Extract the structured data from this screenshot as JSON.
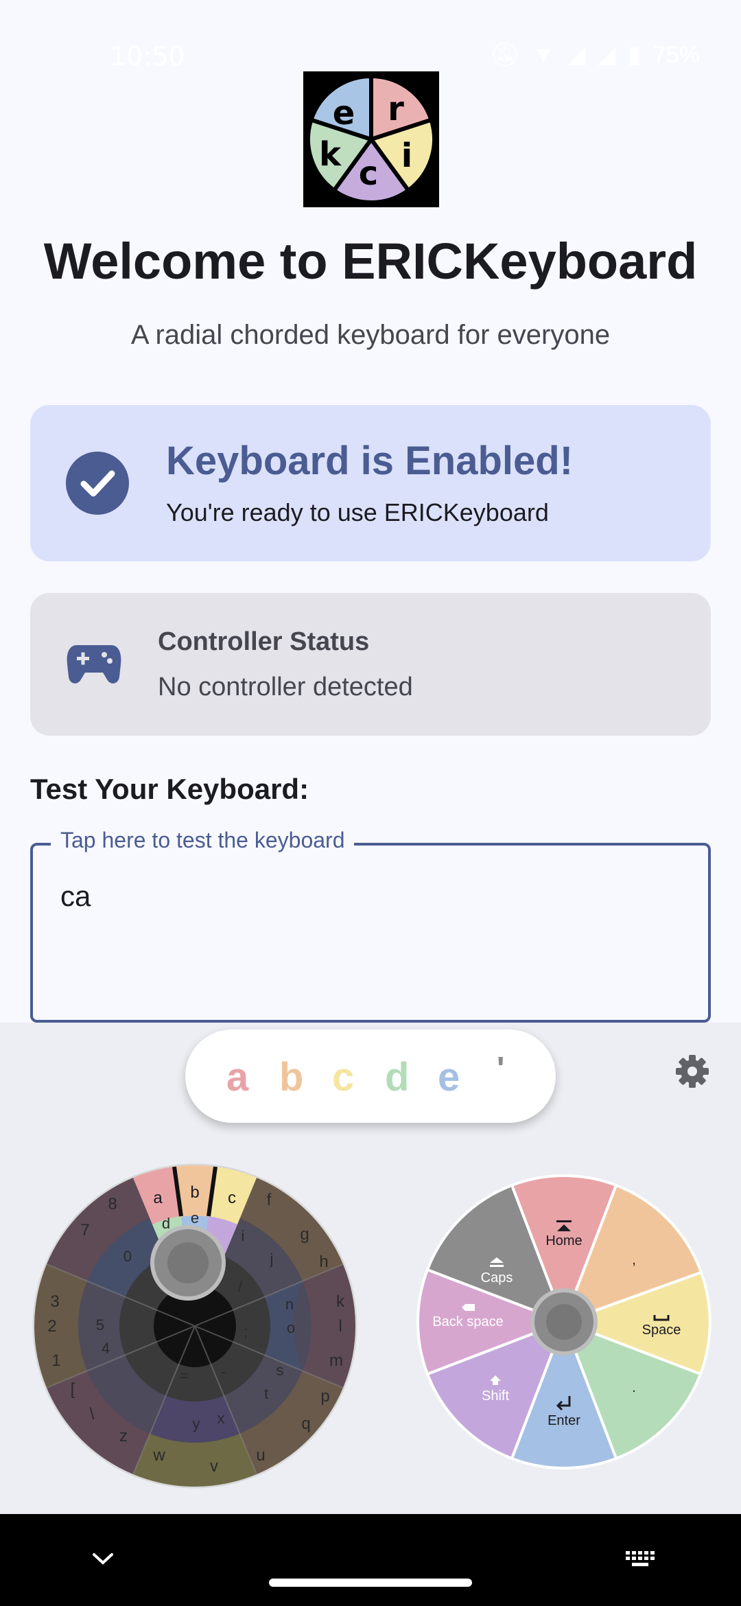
{
  "status_bar": {
    "time": "10:50",
    "battery": "75%",
    "icons": [
      "mute-icon",
      "wifi-icon",
      "signal-icon",
      "signal-icon",
      "battery-icon"
    ]
  },
  "app": {
    "logo_letters": [
      "e",
      "r",
      "k",
      "c",
      "i"
    ],
    "title": "Welcome to ERICKeyboard",
    "subtitle": "A radial chorded keyboard for everyone"
  },
  "enabled_card": {
    "title": "Keyboard is Enabled!",
    "subtitle": "You're ready to use ERICKeyboard",
    "icon": "check-circle-icon",
    "accent": "#4a5c92"
  },
  "controller_card": {
    "title": "Controller Status",
    "subtitle": "No controller detected",
    "icon": "gamepad-icon"
  },
  "test": {
    "label": "Test Your Keyboard:",
    "field_label": "Tap here to test the keyboard",
    "value": "ca"
  },
  "keyboard": {
    "suggestions": [
      {
        "text": "a",
        "color": "#e8a3a6"
      },
      {
        "text": "b",
        "color": "#f1c59b"
      },
      {
        "text": "c",
        "color": "#f4e5a0"
      },
      {
        "text": "d",
        "color": "#b4dcb8"
      },
      {
        "text": "e",
        "color": "#a4c0e4"
      },
      {
        "text": "'",
        "color": "#8a8a8a"
      }
    ],
    "settings_icon": "gear-icon",
    "left_wheel": {
      "highlighted_keys": [
        "a",
        "b",
        "c"
      ],
      "outer_keys": [
        "a",
        "b",
        "c",
        "f",
        "g",
        "h",
        "k",
        "l",
        "m",
        "p",
        "q",
        "u",
        "v",
        "w",
        "z",
        "\\",
        "[",
        "1",
        "2",
        "3",
        "7",
        "8"
      ],
      "inner_keys": [
        "d",
        "e",
        "i",
        "j",
        "n",
        "o",
        "s",
        "t",
        "x",
        "y",
        "0",
        "5",
        "4",
        "/",
        ";",
        "-",
        "="
      ]
    },
    "right_wheel": {
      "keys": [
        {
          "label": "Home",
          "icon": "home-icon",
          "color": "#e8a3a6"
        },
        {
          "label": ",",
          "icon": "",
          "color": "#f1c59b"
        },
        {
          "label": "Space",
          "icon": "space-icon",
          "color": "#f4e5a0"
        },
        {
          "label": ".",
          "icon": "",
          "color": "#b4dcb8"
        },
        {
          "label": "Enter",
          "icon": "enter-icon",
          "color": "#a4c0e4"
        },
        {
          "label": "Shift",
          "icon": "shift-icon",
          "color": "#c3a7dc"
        },
        {
          "label": "Back space",
          "icon": "backspace-icon",
          "color": "#d7a6cf"
        },
        {
          "label": "Caps",
          "icon": "caps-icon",
          "color": "#8c8c8c"
        }
      ]
    }
  },
  "nav_bar": {
    "icons": [
      "chevron-down-icon",
      "home-handle",
      "keyboard-icon"
    ]
  }
}
